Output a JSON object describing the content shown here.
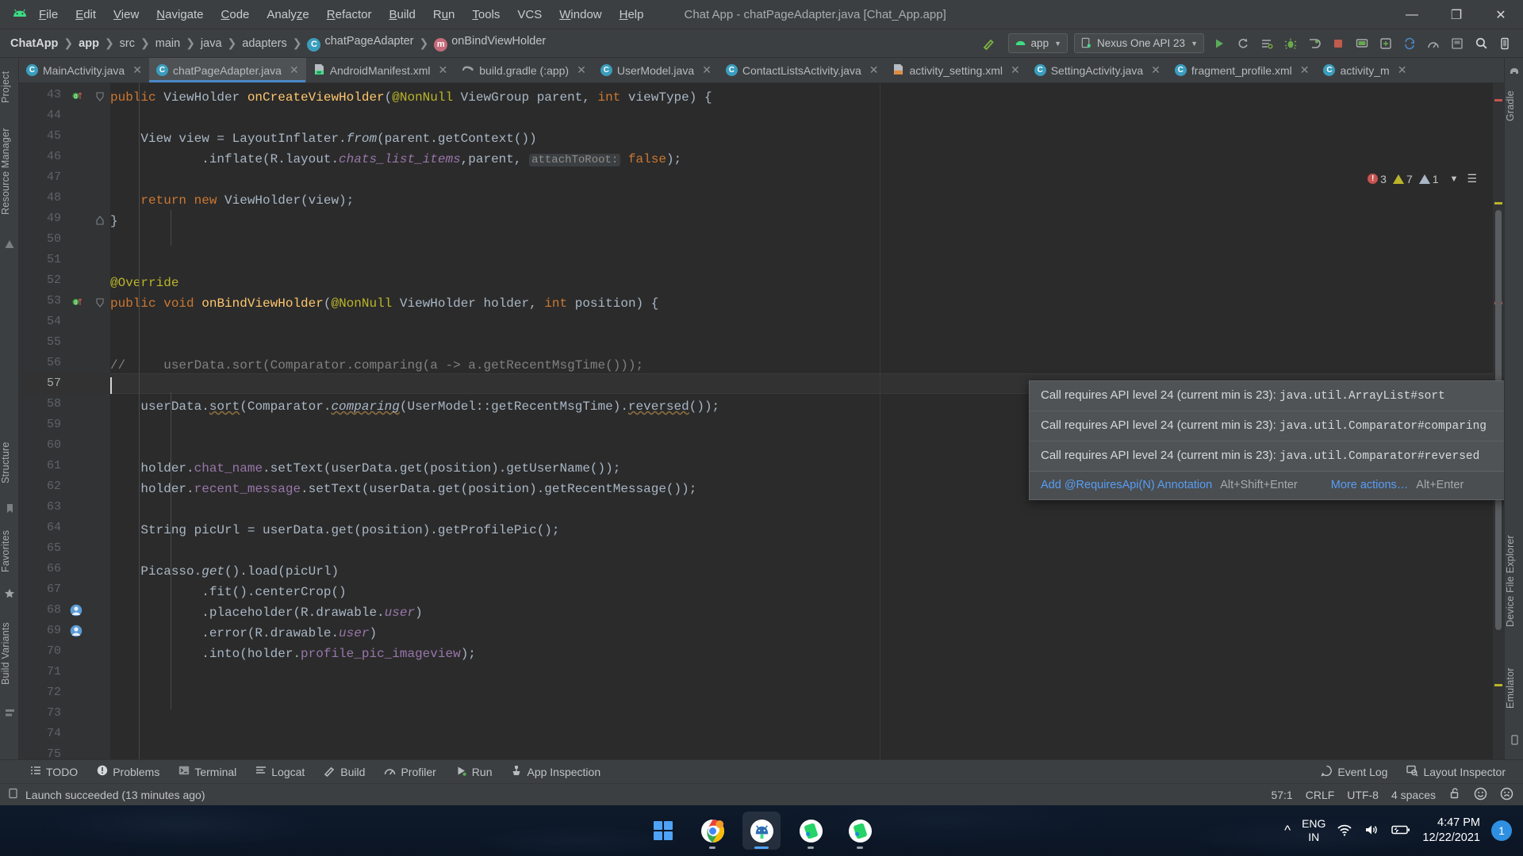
{
  "window": {
    "title": "Chat App - chatPageAdapter.java [Chat_App.app]",
    "minimize": "—",
    "maximize": "❐",
    "close": "✕"
  },
  "menu": {
    "items": [
      {
        "label": "File",
        "mnemonic": "F"
      },
      {
        "label": "Edit",
        "mnemonic": "E"
      },
      {
        "label": "View",
        "mnemonic": "V"
      },
      {
        "label": "Navigate",
        "mnemonic": "N"
      },
      {
        "label": "Code",
        "mnemonic": "C"
      },
      {
        "label": "Analyze",
        "mnemonic": "z"
      },
      {
        "label": "Refactor",
        "mnemonic": "R"
      },
      {
        "label": "Build",
        "mnemonic": "B"
      },
      {
        "label": "Run",
        "mnemonic": "u"
      },
      {
        "label": "Tools",
        "mnemonic": "T"
      },
      {
        "label": "VCS",
        "mnemonic": ""
      },
      {
        "label": "Window",
        "mnemonic": "W"
      },
      {
        "label": "Help",
        "mnemonic": "H"
      }
    ]
  },
  "breadcrumbs": [
    {
      "label": "ChatApp",
      "bold": true,
      "icon": ""
    },
    {
      "label": "app",
      "bold": true,
      "icon": ""
    },
    {
      "label": "src",
      "bold": false,
      "icon": ""
    },
    {
      "label": "main",
      "bold": false,
      "icon": ""
    },
    {
      "label": "java",
      "bold": false,
      "icon": ""
    },
    {
      "label": "adapters",
      "bold": false,
      "icon": ""
    },
    {
      "label": "chatPageAdapter",
      "bold": false,
      "icon": "class-icon"
    },
    {
      "label": "onBindViewHolder",
      "bold": false,
      "icon": "method-icon"
    }
  ],
  "toolbar": {
    "module_selector": "app",
    "device_selector": "Nexus One API 23",
    "icons": [
      "run-icon",
      "debug-rerun-icon",
      "apply-changes-icon",
      "debug-icon",
      "attach-debugger-icon",
      "stop-icon",
      "avd-manager-icon",
      "sdk-manager-icon",
      "sync-gradle-icon",
      "profiler-icon",
      "layout-inspector-icon",
      "search-icon",
      "device-manager-icon"
    ],
    "hammer_icon": "build-hammer-icon"
  },
  "tabs": [
    {
      "label": "MainActivity.java",
      "type": "java",
      "active": false
    },
    {
      "label": "chatPageAdapter.java",
      "type": "java",
      "active": true
    },
    {
      "label": "AndroidManifest.xml",
      "type": "manifest",
      "active": false
    },
    {
      "label": "build.gradle (:app)",
      "type": "gradle",
      "active": false
    },
    {
      "label": "UserModel.java",
      "type": "java",
      "active": false
    },
    {
      "label": "ContactListsActivity.java",
      "type": "java",
      "active": false
    },
    {
      "label": "activity_setting.xml",
      "type": "layout",
      "active": false
    },
    {
      "label": "SettingActivity.java",
      "type": "java",
      "active": false
    },
    {
      "label": "fragment_profile.xml",
      "type": "java",
      "active": false
    },
    {
      "label": "activity_m",
      "type": "java",
      "active": false
    }
  ],
  "left_tool_strip": [
    {
      "label": "Project",
      "name": "tool-project"
    },
    {
      "label": "Resource Manager",
      "name": "tool-resource-manager"
    },
    {
      "label": "Structure",
      "name": "tool-structure"
    },
    {
      "label": "Favorites",
      "name": "tool-favorites"
    },
    {
      "label": "Build Variants",
      "name": "tool-build-variants"
    }
  ],
  "right_tool_strip": [
    {
      "label": "Gradle",
      "name": "tool-gradle"
    },
    {
      "label": "Device File Explorer",
      "name": "tool-device-file-explorer"
    },
    {
      "label": "Emulator",
      "name": "tool-emulator"
    }
  ],
  "editor": {
    "first_line": 43,
    "current_line": 57,
    "lines": [
      {
        "n": 43,
        "html": "<span class=\"kw\">public</span> ViewHolder <span class=\"fn\">onCreateViewHolder</span>(<span class=\"ann\">@NonNull</span> ViewGroup parent, <span class=\"kw\">int</span> viewType) {",
        "indent": 0,
        "marker": "override-impl"
      },
      {
        "n": 44,
        "html": "",
        "indent": 0,
        "marker": ""
      },
      {
        "n": 45,
        "html": "    View view = LayoutInflater.<span class=\"ital\">from</span>(parent.getContext())",
        "indent": 0,
        "marker": ""
      },
      {
        "n": 46,
        "html": "            .inflate(R.layout.<span class=\"fld ital\">chats_list_items</span>,parent, <span class=\"param-hint\">attachToRoot:</span> <span class=\"kw\">false</span>);",
        "indent": 0,
        "marker": ""
      },
      {
        "n": 47,
        "html": "",
        "indent": 0,
        "marker": ""
      },
      {
        "n": 48,
        "html": "    <span class=\"kw\">return new</span> ViewHolder(view);",
        "indent": 0,
        "marker": ""
      },
      {
        "n": 49,
        "html": "}",
        "indent": 0,
        "marker": "fold-end"
      },
      {
        "n": 50,
        "html": "",
        "indent": 0,
        "marker": ""
      },
      {
        "n": 51,
        "html": "",
        "indent": 0,
        "marker": ""
      },
      {
        "n": 52,
        "html": "<span class=\"ann\">@Override</span>",
        "indent": 0,
        "marker": ""
      },
      {
        "n": 53,
        "html": "<span class=\"kw\">public void</span> <span class=\"fn\">onBindViewHolder</span>(<span class=\"ann\">@NonNull</span> ViewHolder holder, <span class=\"kw\">int</span> position) {",
        "indent": 0,
        "marker": "override-impl"
      },
      {
        "n": 54,
        "html": "",
        "indent": 0,
        "marker": ""
      },
      {
        "n": 55,
        "html": "",
        "indent": 0,
        "marker": ""
      },
      {
        "n": 56,
        "html": "<span class=\"cmt\">//     userData.sort(Comparator.comparing(a -&gt; a.getRecentMsgTime()));</span>",
        "indent": 0,
        "marker": ""
      },
      {
        "n": 57,
        "html": "",
        "indent": 0,
        "marker": "",
        "current": true
      },
      {
        "n": 58,
        "html": "    userData.<span class=\"err-squiggle\">sort</span>(Comparator.<span class=\"ital err-squiggle\">comparing</span>(UserModel::getRecentMsgTime).<span class=\"err-squiggle\">reversed</span>());",
        "indent": 0,
        "marker": ""
      },
      {
        "n": 59,
        "html": "",
        "indent": 0,
        "marker": ""
      },
      {
        "n": 60,
        "html": "",
        "indent": 0,
        "marker": ""
      },
      {
        "n": 61,
        "html": "    holder.<span class=\"fld\">chat_name</span>.setText(userData.get(position).getUserName());",
        "indent": 0,
        "marker": ""
      },
      {
        "n": 62,
        "html": "    holder.<span class=\"fld\">recent_message</span>.setText(userData.get(position).getRecentMessage());",
        "indent": 0,
        "marker": ""
      },
      {
        "n": 63,
        "html": "",
        "indent": 0,
        "marker": ""
      },
      {
        "n": 64,
        "html": "    String picUrl = userData.get(position).getProfilePic();",
        "indent": 0,
        "marker": ""
      },
      {
        "n": 65,
        "html": "",
        "indent": 0,
        "marker": ""
      },
      {
        "n": 66,
        "html": "    Picasso.<span class=\"ital\">get</span>().load(picUrl)",
        "indent": 0,
        "marker": ""
      },
      {
        "n": 67,
        "html": "            .fit().centerCrop()",
        "indent": 0,
        "marker": ""
      },
      {
        "n": 68,
        "html": "            .placeholder(R.drawable.<span class=\"fld ital\">user</span>)",
        "indent": 0,
        "marker": "image-gutter"
      },
      {
        "n": 69,
        "html": "            .error(R.drawable.<span class=\"fld ital\">user</span>)",
        "indent": 0,
        "marker": "image-gutter"
      },
      {
        "n": 70,
        "html": "            .into(holder.<span class=\"fld\">profile_pic_imageview</span>);",
        "indent": 0,
        "marker": ""
      },
      {
        "n": 71,
        "html": "",
        "indent": 0,
        "marker": ""
      },
      {
        "n": 72,
        "html": "",
        "indent": 0,
        "marker": ""
      },
      {
        "n": 73,
        "html": "",
        "indent": 0,
        "marker": ""
      },
      {
        "n": 74,
        "html": "",
        "indent": 0,
        "marker": ""
      },
      {
        "n": 75,
        "html": "",
        "indent": 0,
        "marker": ""
      }
    ]
  },
  "inspection_widget": {
    "error_count": "3",
    "warning_count": "7",
    "weak_warning_count": "1"
  },
  "inspection_popup": {
    "rows": [
      {
        "prefix": "Call requires API level 24 (current min is 23): ",
        "mono": "java.util.ArrayList#sort"
      },
      {
        "prefix": "Call requires API level 24 (current min is 23): ",
        "mono": "java.util.Comparator#comparing"
      },
      {
        "prefix": "Call requires API level 24 (current min is 23): ",
        "mono": "java.util.Comparator#reversed"
      }
    ],
    "primary_action": "Add @RequiresApi(N) Annotation",
    "primary_shortcut": "Alt+Shift+Enter",
    "secondary_action": "More actions…",
    "secondary_shortcut": "Alt+Enter"
  },
  "bottom_bar": {
    "items": [
      {
        "label": "TODO",
        "icon": "todo-icon"
      },
      {
        "label": "Problems",
        "icon": "problems-icon"
      },
      {
        "label": "Terminal",
        "icon": "terminal-icon"
      },
      {
        "label": "Logcat",
        "icon": "logcat-icon"
      },
      {
        "label": "Build",
        "icon": "build-hammer-icon"
      },
      {
        "label": "Profiler",
        "icon": "profiler-icon"
      },
      {
        "label": "Run",
        "icon": "run-icon"
      },
      {
        "label": "App Inspection",
        "icon": "app-inspection-icon"
      }
    ],
    "right_items": [
      {
        "label": "Event Log",
        "icon": "event-log-icon"
      },
      {
        "label": "Layout Inspector",
        "icon": "layout-inspector-icon"
      }
    ]
  },
  "status_bar": {
    "message": "Launch succeeded (13 minutes ago)",
    "caret_position": "57:1",
    "line_separator": "CRLF",
    "encoding": "UTF-8",
    "indent": "4 spaces",
    "lock_icon": "unlocked-icon",
    "happy_icon": "happy-face-icon",
    "sad_icon": "sad-face-icon"
  },
  "taskbar": {
    "apps": [
      {
        "name": "start-button",
        "active": false
      },
      {
        "name": "chrome-icon",
        "active": false
      },
      {
        "name": "android-studio-icon",
        "active": true
      },
      {
        "name": "whatsapp-web-icon",
        "active": false
      },
      {
        "name": "whatsapp-web-icon-2",
        "active": false
      }
    ],
    "tray": {
      "chevron": "⌃",
      "language_line1": "ENG",
      "language_line2": "IN",
      "wifi_icon": "wifi-icon",
      "volume_icon": "volume-icon",
      "battery_icon": "battery-charging-icon",
      "time": "4:47 PM",
      "date": "12/22/2021",
      "notification_count": "1"
    }
  }
}
